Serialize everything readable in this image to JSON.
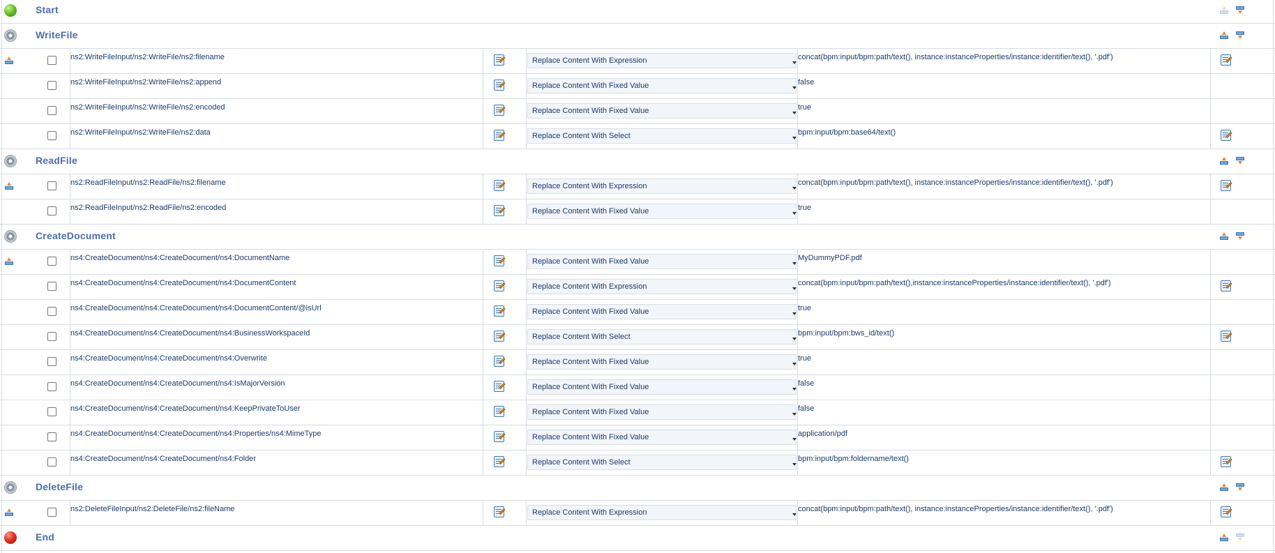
{
  "mapping_sections": [
    {
      "id": "start",
      "title": "Start",
      "icon": "green-ball-icon",
      "up_enabled": false,
      "down_enabled": true,
      "rows": []
    },
    {
      "id": "writefile",
      "title": "WriteFile",
      "icon": "gear-icon",
      "up_enabled": true,
      "down_enabled": true,
      "rows": [
        {
          "xpath": "ns2:WriteFileInput/ns2:WriteFile/ns2:filename",
          "mode": "Replace Content With Expression",
          "value": "concat(bpm:input/bpm:path/text(), instance:instanceProperties/instance:identifier/text(), '.pdf')",
          "has_value_editor": true
        },
        {
          "xpath": "ns2:WriteFileInput/ns2:WriteFile/ns2:append",
          "mode": "Replace Content With Fixed Value",
          "value": "false",
          "has_value_editor": false
        },
        {
          "xpath": "ns2:WriteFileInput/ns2:WriteFile/ns2:encoded",
          "mode": "Replace Content With Fixed Value",
          "value": "true",
          "has_value_editor": false
        },
        {
          "xpath": "ns2:WriteFileInput/ns2:WriteFile/ns2:data",
          "mode": "Replace Content With Select",
          "value": "bpm:input/bpm:base64/text()",
          "has_value_editor": true
        }
      ]
    },
    {
      "id": "readfile",
      "title": "ReadFile",
      "icon": "gear-icon",
      "up_enabled": true,
      "down_enabled": true,
      "rows": [
        {
          "xpath": "ns2:ReadFileInput/ns2:ReadFile/ns2:filename",
          "mode": "Replace Content With Expression",
          "value": "concat(bpm:input/bpm:path/text(), instance:instanceProperties/instance:identifier/text(), '.pdf')",
          "has_value_editor": true
        },
        {
          "xpath": "ns2:ReadFileInput/ns2:ReadFile/ns2:encoded",
          "mode": "Replace Content With Fixed Value",
          "value": "true",
          "has_value_editor": false
        }
      ]
    },
    {
      "id": "createdocument",
      "title": "CreateDocument",
      "icon": "gear-icon",
      "up_enabled": true,
      "down_enabled": true,
      "rows": [
        {
          "xpath": "ns4:CreateDocument/ns4:CreateDocument/ns4:DocumentName",
          "mode": "Replace Content With Fixed Value",
          "value": "MyDummyPDF.pdf",
          "has_value_editor": false
        },
        {
          "xpath": "ns4:CreateDocument/ns4:CreateDocument/ns4:DocumentContent",
          "mode": "Replace Content With Expression",
          "value": "concat(bpm:input/bpm:path/text(),instance:instanceProperties/instance:identifier/text(), '.pdf')",
          "has_value_editor": true
        },
        {
          "xpath": "ns4:CreateDocument/ns4:CreateDocument/ns4:DocumentContent/@isUrl",
          "mode": "Replace Content With Fixed Value",
          "value": "true",
          "has_value_editor": false
        },
        {
          "xpath": "ns4:CreateDocument/ns4:CreateDocument/ns4:BusinessWorkspaceId",
          "mode": "Replace Content With Select",
          "value": "bpm:input/bpm:bws_id/text()",
          "has_value_editor": true
        },
        {
          "xpath": "ns4:CreateDocument/ns4:CreateDocument/ns4:Overwrite",
          "mode": "Replace Content With Fixed Value",
          "value": "true",
          "has_value_editor": false
        },
        {
          "xpath": "ns4:CreateDocument/ns4:CreateDocument/ns4:IsMajorVersion",
          "mode": "Replace Content With Fixed Value",
          "value": "false",
          "has_value_editor": false
        },
        {
          "xpath": "ns4:CreateDocument/ns4:CreateDocument/ns4:KeepPrivateToUser",
          "mode": "Replace Content With Fixed Value",
          "value": "false",
          "has_value_editor": false
        },
        {
          "xpath": "ns4:CreateDocument/ns4:CreateDocument/ns4:Properties/ns4:MimeType",
          "mode": "Replace Content With Fixed Value",
          "value": "application/pdf",
          "has_value_editor": false
        },
        {
          "xpath": "ns4:CreateDocument/ns4:CreateDocument/ns4:Folder",
          "mode": "Replace Content With Select",
          "value": "bpm:input/bpm:foldername/text()",
          "has_value_editor": true
        }
      ]
    },
    {
      "id": "deletefile",
      "title": "DeleteFile",
      "icon": "gear-icon",
      "up_enabled": true,
      "down_enabled": true,
      "rows": [
        {
          "xpath": "ns2:DeleteFileInput/ns2:DeleteFile/ns2:fileName",
          "mode": "Replace Content With Expression",
          "value": "concat(bpm:input/bpm:path/text(), instance:instanceProperties/instance:identifier/text(), '.pdf')",
          "has_value_editor": true
        }
      ]
    },
    {
      "id": "end",
      "title": "End",
      "icon": "red-ball-icon",
      "up_enabled": true,
      "down_enabled": false,
      "rows": []
    }
  ]
}
